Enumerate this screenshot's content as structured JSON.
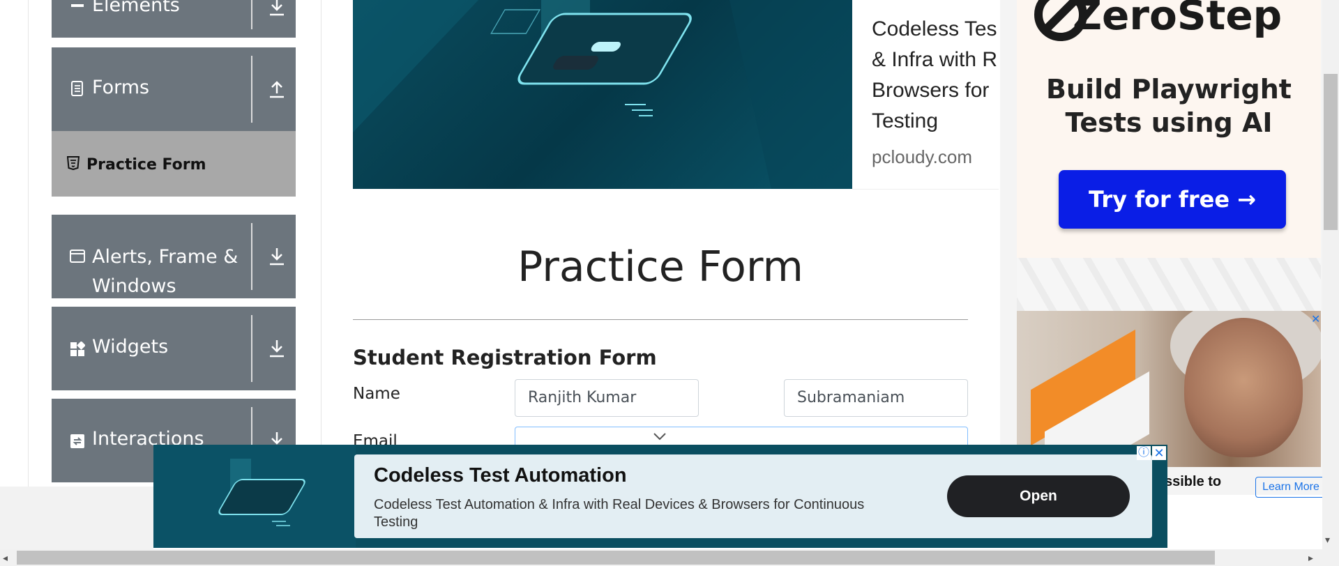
{
  "sidebar": {
    "groups": [
      {
        "label": "Elements",
        "icon": "list-icon"
      },
      {
        "label": "Forms",
        "icon": "document-icon"
      },
      {
        "label": "Alerts, Frame & Windows",
        "icon": "window-icon"
      },
      {
        "label": "Widgets",
        "icon": "widgets-icon"
      },
      {
        "label": "Interactions",
        "icon": "interactions-icon"
      }
    ],
    "active_item": "Practice Form"
  },
  "banner_ad": {
    "text": "Codeless Test Automation & Infra with Real Browsers for Continuous Testing",
    "visible_text": "Codeless Tes & Infra with R Browsers for Testing",
    "line1": "Codeless Tes",
    "line2": "& Infra with R",
    "line3": "Browsers for",
    "line4": "Testing",
    "domain": "pcloudy.com"
  },
  "zerostep_ad": {
    "brand": "ZeroStep",
    "headline": "Build Playwright Tests using AI",
    "button": "Try for free →"
  },
  "photo_ad": {
    "caption": "ssible to",
    "learn_more": "Learn More"
  },
  "page": {
    "title": "Practice Form",
    "form_heading": "Student Registration Form"
  },
  "form": {
    "name_label": "Name",
    "first_name": "Ranjith Kumar",
    "last_name": "Subramaniam",
    "email_label": "Email"
  },
  "bottom_ad": {
    "title": "Codeless Test Automation",
    "description": "Codeless Test Automation & Infra with Real Devices & Browsers for Continuous Testing",
    "button": "Open"
  },
  "colors": {
    "sidebar_group": "#6c757d",
    "active_item": "#a8a8a8",
    "zerostep_button": "#0a1ee6",
    "ad_teal": "#0a4e60"
  }
}
